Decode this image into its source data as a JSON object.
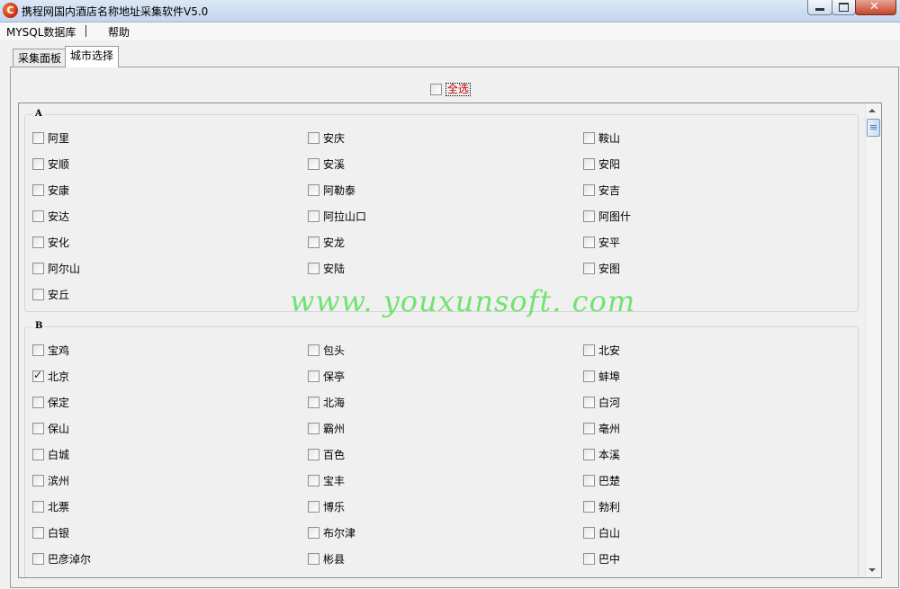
{
  "window": {
    "title": "携程网国内酒店名称地址采集软件V5.0",
    "icon": "app-logo-icon"
  },
  "menu": [
    "MYSQL数据库",
    "帮助"
  ],
  "tabs": [
    {
      "label": "采集面板",
      "active": false
    },
    {
      "label": "城市选择",
      "active": true
    }
  ],
  "select_all": {
    "label": "全选",
    "checked": false
  },
  "groups": [
    {
      "letter": "A",
      "cities": [
        {
          "name": "阿里",
          "checked": false
        },
        {
          "name": "安庆",
          "checked": false
        },
        {
          "name": "鞍山",
          "checked": false
        },
        {
          "name": "安顺",
          "checked": false
        },
        {
          "name": "安溪",
          "checked": false
        },
        {
          "name": "安阳",
          "checked": false
        },
        {
          "name": "安康",
          "checked": false
        },
        {
          "name": "阿勒泰",
          "checked": false
        },
        {
          "name": "安吉",
          "checked": false
        },
        {
          "name": "安达",
          "checked": false
        },
        {
          "name": "阿拉山口",
          "checked": false
        },
        {
          "name": "阿图什",
          "checked": false
        },
        {
          "name": "安化",
          "checked": false
        },
        {
          "name": "安龙",
          "checked": false
        },
        {
          "name": "安平",
          "checked": false
        },
        {
          "name": "阿尔山",
          "checked": false
        },
        {
          "name": "安陆",
          "checked": false
        },
        {
          "name": "安图",
          "checked": false
        },
        {
          "name": "安丘",
          "checked": false
        }
      ]
    },
    {
      "letter": "B",
      "cities": [
        {
          "name": "宝鸡",
          "checked": false
        },
        {
          "name": "包头",
          "checked": false
        },
        {
          "name": "北安",
          "checked": false
        },
        {
          "name": "北京",
          "checked": true
        },
        {
          "name": "保亭",
          "checked": false
        },
        {
          "name": "蚌埠",
          "checked": false
        },
        {
          "name": "保定",
          "checked": false
        },
        {
          "name": "北海",
          "checked": false
        },
        {
          "name": "白河",
          "checked": false
        },
        {
          "name": "保山",
          "checked": false
        },
        {
          "name": "霸州",
          "checked": false
        },
        {
          "name": "亳州",
          "checked": false
        },
        {
          "name": "白城",
          "checked": false
        },
        {
          "name": "百色",
          "checked": false
        },
        {
          "name": "本溪",
          "checked": false
        },
        {
          "name": "滨州",
          "checked": false
        },
        {
          "name": "宝丰",
          "checked": false
        },
        {
          "name": "巴楚",
          "checked": false
        },
        {
          "name": "北票",
          "checked": false
        },
        {
          "name": "博乐",
          "checked": false
        },
        {
          "name": "勃利",
          "checked": false
        },
        {
          "name": "白银",
          "checked": false
        },
        {
          "name": "布尔津",
          "checked": false
        },
        {
          "name": "白山",
          "checked": false
        },
        {
          "name": "巴彦淖尔",
          "checked": false
        },
        {
          "name": "彬县",
          "checked": false
        },
        {
          "name": "巴中",
          "checked": false
        }
      ]
    }
  ],
  "watermark": "www. youxunsoft. com"
}
